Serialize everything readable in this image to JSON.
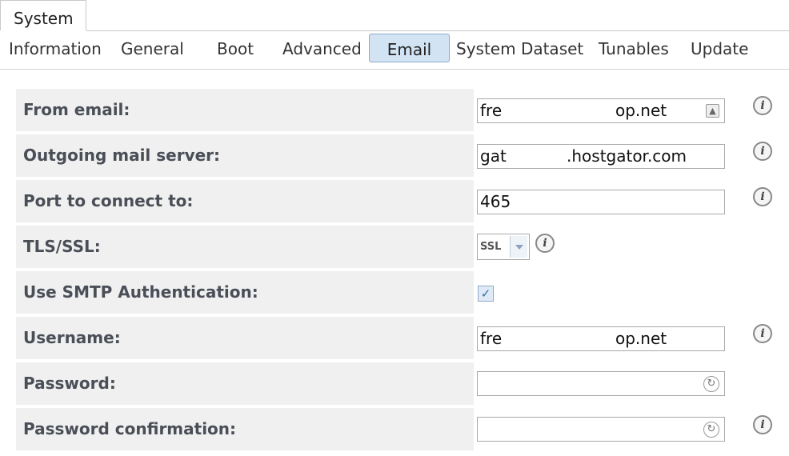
{
  "window": {
    "tab_label": "System"
  },
  "subtabs": [
    {
      "label": "Information"
    },
    {
      "label": "General"
    },
    {
      "label": "Boot"
    },
    {
      "label": "Advanced"
    },
    {
      "label": "Email",
      "active": true
    },
    {
      "label": "System Dataset"
    },
    {
      "label": "Tunables"
    },
    {
      "label": "Update"
    }
  ],
  "form": {
    "from_email": {
      "label": "From email:",
      "value_start": "fre",
      "value_end": "op.net"
    },
    "outgoing_mail_server": {
      "label": "Outgoing mail server:",
      "value_start": "gat",
      "value_end": ".hostgator.com"
    },
    "port": {
      "label": "Port to connect to:",
      "value": "465"
    },
    "tls_ssl": {
      "label": "TLS/SSL:",
      "value": "SSL"
    },
    "smtp_auth": {
      "label": "Use SMTP Authentication:",
      "checked": true,
      "check_glyph": "✓"
    },
    "username": {
      "label": "Username:",
      "value_start": "fre",
      "value_end": "op.net"
    },
    "password": {
      "label": "Password:",
      "value": ""
    },
    "password_confirmation": {
      "label": "Password confirmation:",
      "value": ""
    }
  },
  "icons": {
    "info": "i",
    "contact": "▲",
    "reveal": "↻"
  }
}
